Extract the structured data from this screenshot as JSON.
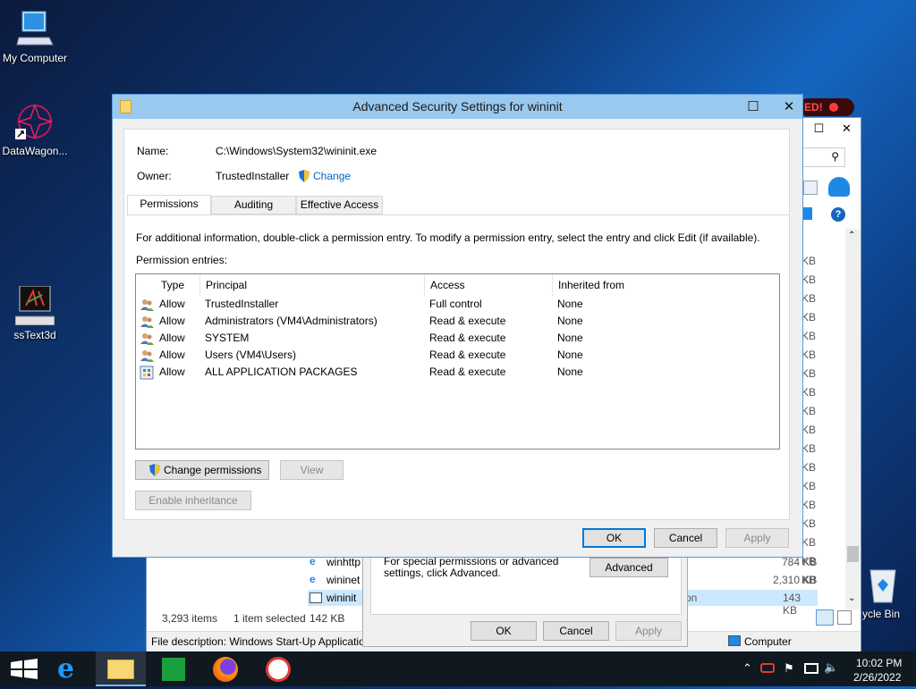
{
  "desktop": {
    "icons": [
      {
        "label": "My Computer"
      },
      {
        "label": "DataWagon..."
      },
      {
        "label": "ssText3d"
      },
      {
        "label": "ycle Bin"
      }
    ],
    "recording_badge": "ED!"
  },
  "explorer": {
    "sizes": [
      "KB",
      "KB",
      "KB",
      "KB",
      "KB",
      "KB",
      "KB",
      "KB",
      "KB",
      "KB",
      "KB",
      "KB",
      "KB",
      "KB",
      "KB",
      "KB",
      "KB",
      "KB"
    ],
    "files": [
      {
        "name": "winhttp",
        "size": "784 KB"
      },
      {
        "name": "wininet",
        "size": "2,310 KB"
      },
      {
        "name": "wininit",
        "size": "143 KB",
        "type_fragment": "on"
      }
    ],
    "status": {
      "items": "3,293 items",
      "selected": "1 item selected",
      "selected_size": "142 KB"
    },
    "description": "File description: Windows Start-Up Applicatio",
    "computer_label": "Computer"
  },
  "properties": {
    "advanced_text": "For special permissions or advanced settings, click Advanced.",
    "advanced_button": "Advanced",
    "ok": "OK",
    "cancel": "Cancel",
    "apply": "Apply"
  },
  "dialog": {
    "title": "Advanced Security Settings for wininit",
    "name_label": "Name:",
    "name_value": "C:\\Windows\\System32\\wininit.exe",
    "owner_label": "Owner:",
    "owner_value": "TrustedInstaller",
    "change_link": "Change",
    "tabs": [
      "Permissions",
      "Auditing",
      "Effective Access"
    ],
    "info": "For additional information, double-click a permission entry. To modify a permission entry, select the entry and click Edit (if available).",
    "entries_label": "Permission entries:",
    "columns": [
      "Type",
      "Principal",
      "Access",
      "Inherited from"
    ],
    "entries": [
      {
        "type": "Allow",
        "principal": "TrustedInstaller",
        "access": "Full control",
        "inherited": "None"
      },
      {
        "type": "Allow",
        "principal": "Administrators (VM4\\Administrators)",
        "access": "Read & execute",
        "inherited": "None"
      },
      {
        "type": "Allow",
        "principal": "SYSTEM",
        "access": "Read & execute",
        "inherited": "None"
      },
      {
        "type": "Allow",
        "principal": "Users (VM4\\Users)",
        "access": "Read & execute",
        "inherited": "None"
      },
      {
        "type": "Allow",
        "principal": "ALL APPLICATION PACKAGES",
        "access": "Read & execute",
        "inherited": "None"
      }
    ],
    "change_permissions": "Change permissions",
    "view": "View",
    "enable_inheritance": "Enable inheritance",
    "ok": "OK",
    "cancel": "Cancel",
    "apply": "Apply"
  },
  "taskbar": {
    "time": "10:02 PM",
    "date": "2/26/2022"
  }
}
